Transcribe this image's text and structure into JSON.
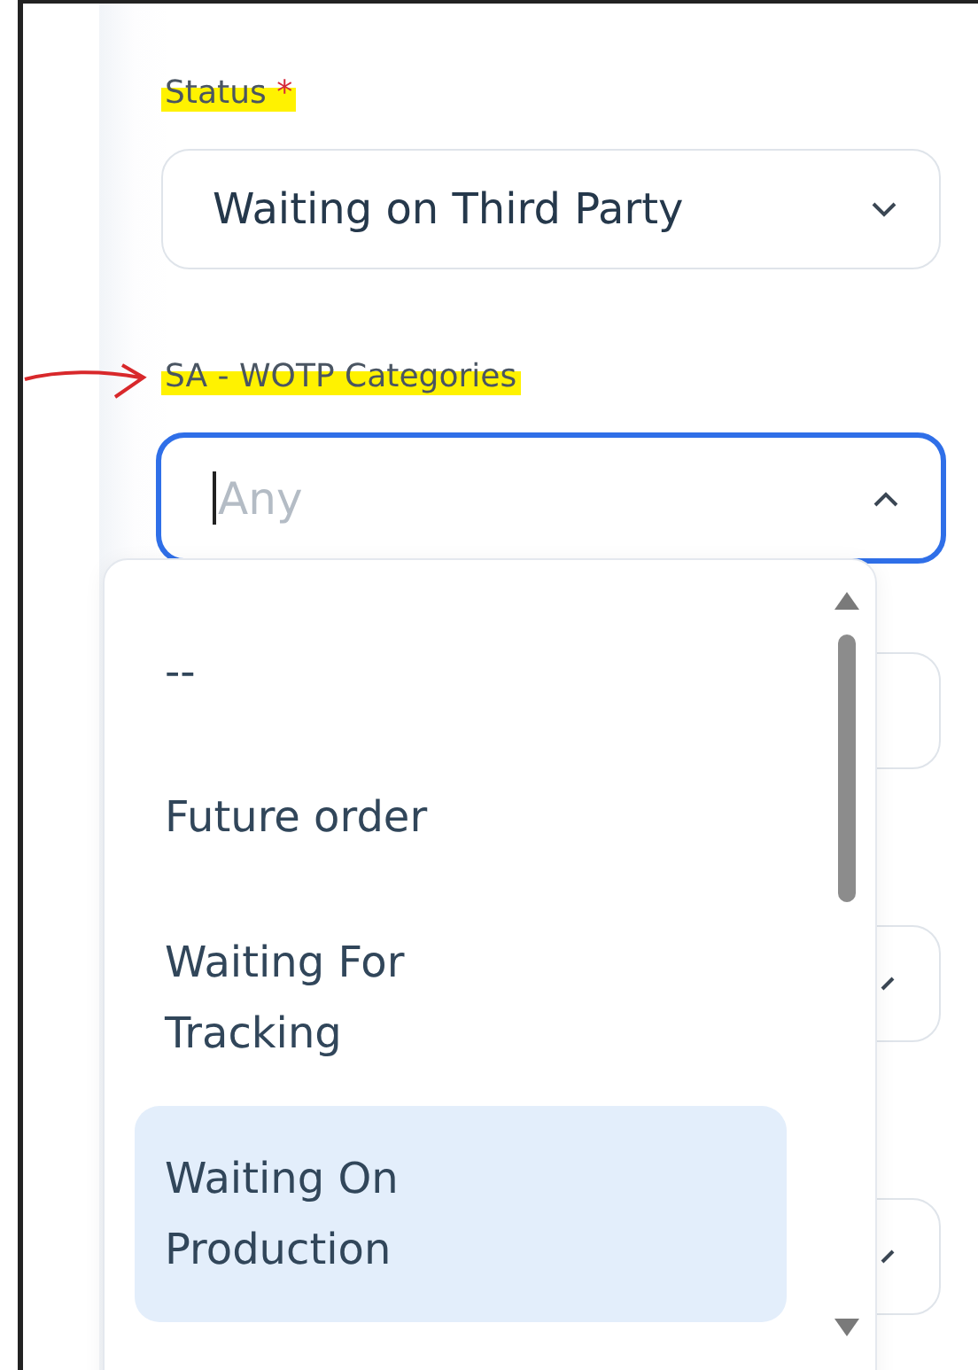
{
  "status_field": {
    "label": "Status",
    "required_mark": "*",
    "value": "Waiting on Third Party",
    "open": false,
    "highlighted": true
  },
  "category_field": {
    "label": "SA - WOTP Categories",
    "placeholder": "Any",
    "open": true,
    "highlighted": true,
    "pointed_at": true
  },
  "covered_fields": [
    {
      "kind": "text"
    },
    {
      "kind": "select"
    },
    {
      "kind": "select"
    }
  ],
  "dropdown": {
    "options": [
      {
        "label": "--",
        "selected": false
      },
      {
        "label": "Future order",
        "selected": false
      },
      {
        "label": "Waiting For Tracking",
        "selected": false
      },
      {
        "label": "Waiting On Production",
        "selected": true
      }
    ]
  }
}
